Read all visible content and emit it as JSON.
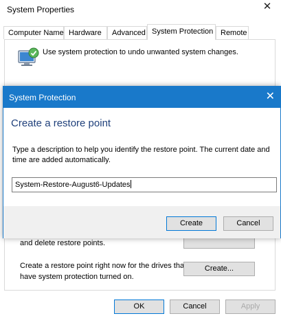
{
  "window": {
    "title": "System Properties",
    "close_glyph": "✕",
    "tabs": [
      {
        "label": "Computer Name"
      },
      {
        "label": "Hardware"
      },
      {
        "label": "Advanced"
      },
      {
        "label": "System Protection",
        "active": true
      },
      {
        "label": "Remote"
      }
    ],
    "intro_text": "Use system protection to undo unwanted system changes.",
    "manage_text": "and delete restore points.",
    "create_text_line1": "Create a restore point right now for the drives that",
    "create_text_line2": "have system protection turned on.",
    "create_button": "Create...",
    "footer": {
      "ok": "OK",
      "cancel": "Cancel",
      "apply": "Apply"
    }
  },
  "dialog": {
    "title": "System Protection",
    "close_glyph": "✕",
    "heading": "Create a restore point",
    "description": "Type a description to help you identify the restore point. The current date and time are added automatically.",
    "input_value": "System-Restore-August6-Updates",
    "create_button": "Create",
    "cancel_button": "Cancel"
  },
  "colors": {
    "accent": "#1979ca",
    "heading": "#1e3f7a"
  }
}
